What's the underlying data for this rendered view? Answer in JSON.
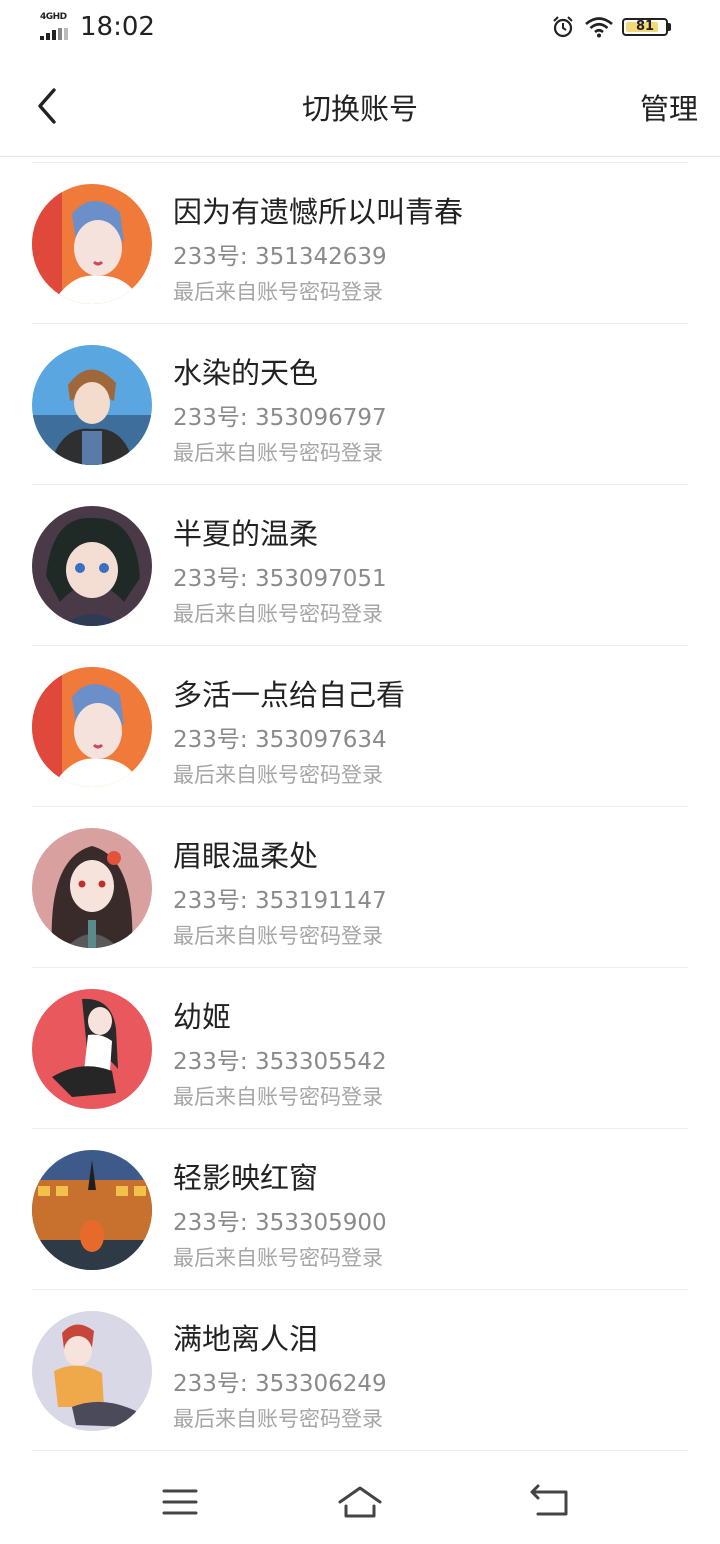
{
  "status_bar": {
    "network": "4GHD",
    "time": "18:02",
    "battery": "81",
    "icons": [
      "signal-icon",
      "alarm-icon",
      "wifi-icon",
      "battery-icon"
    ]
  },
  "header": {
    "title": "切换账号",
    "manage_label": "管理",
    "back_icon": "chevron-left-icon"
  },
  "accounts": [
    {
      "name": "因为有遗憾所以叫青春",
      "id": "233号: 351342639",
      "login": "最后来自账号密码登录",
      "avatar_colors": [
        "#f07a3a",
        "#6b8fc9"
      ]
    },
    {
      "name": "水染的天色",
      "id": "233号: 353096797",
      "login": "最后来自账号密码登录",
      "avatar_colors": [
        "#5aa6e0",
        "#3b3b3b"
      ]
    },
    {
      "name": "半夏的温柔",
      "id": "233号: 353097051",
      "login": "最后来自账号密码登录",
      "avatar_colors": [
        "#2b2b3a",
        "#f1d6c8"
      ]
    },
    {
      "name": "多活一点给自己看",
      "id": "233号: 353097634",
      "login": "最后来自账号密码登录",
      "avatar_colors": [
        "#f07a3a",
        "#6b8fc9"
      ]
    },
    {
      "name": "眉眼温柔处",
      "id": "233号: 353191147",
      "login": "最后来自账号密码登录",
      "avatar_colors": [
        "#d9a0a0",
        "#3a2b2b"
      ]
    },
    {
      "name": "幼姬",
      "id": "233号: 353305542",
      "login": "最后来自账号密码登录",
      "avatar_colors": [
        "#e8585c",
        "#2a2a2a"
      ]
    },
    {
      "name": "轻影映红窗",
      "id": "233号: 353305900",
      "login": "最后来自账号密码登录",
      "avatar_colors": [
        "#c8702e",
        "#3d5a8a"
      ]
    },
    {
      "name": "满地离人泪",
      "id": "233号: 353306249",
      "login": "最后来自账号密码登录",
      "avatar_colors": [
        "#d8d8e6",
        "#f0a94a"
      ]
    }
  ],
  "bottom_nav": {
    "icons": [
      "menu-icon",
      "home-icon",
      "back-return-icon"
    ]
  }
}
